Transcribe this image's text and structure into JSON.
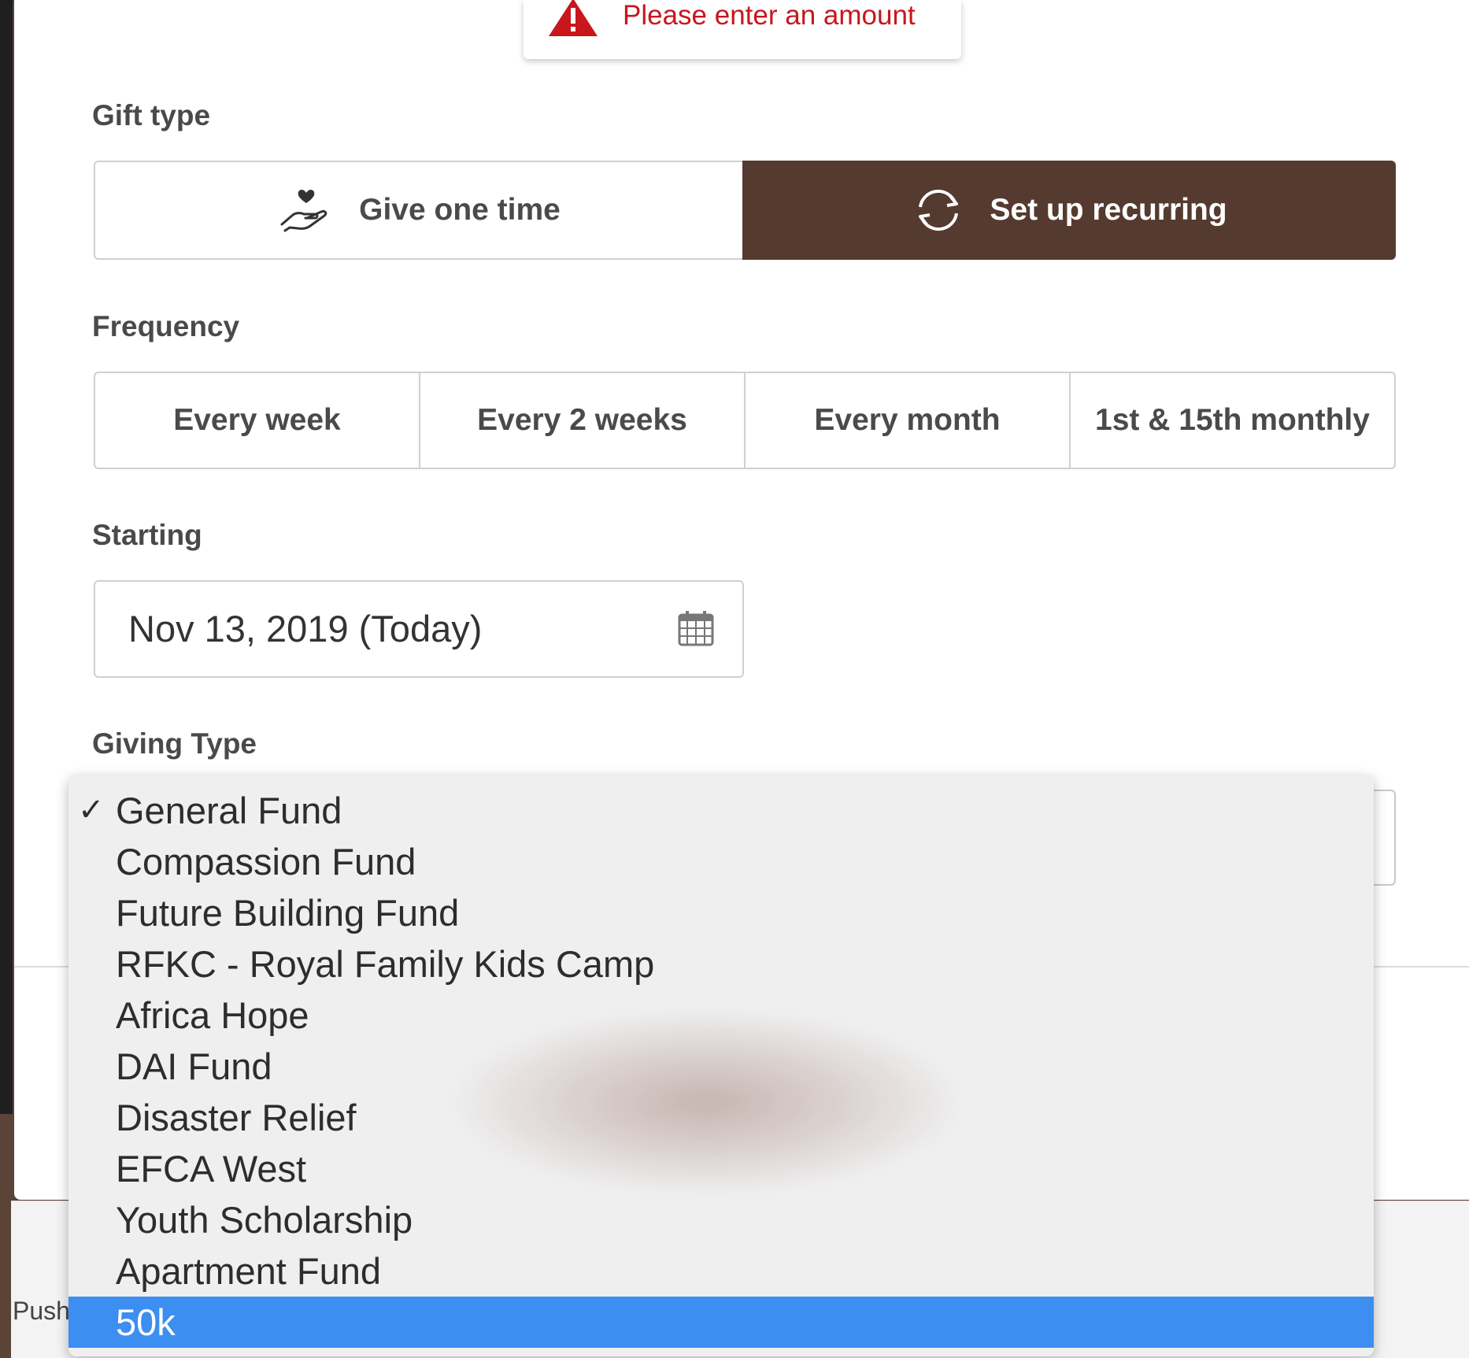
{
  "toast": {
    "message": "Please enter an amount",
    "icon": "warning-triangle-icon"
  },
  "gift_type": {
    "label": "Gift type",
    "options": [
      {
        "label": "Give one time",
        "icon": "hand-heart-icon",
        "selected": false
      },
      {
        "label": "Set up recurring",
        "icon": "recurring-arrows-icon",
        "selected": true
      }
    ]
  },
  "frequency": {
    "label": "Frequency",
    "options": [
      "Every week",
      "Every 2 weeks",
      "Every month",
      "1st & 15th monthly"
    ]
  },
  "starting": {
    "label": "Starting",
    "value": "Nov 13, 2019 (Today)",
    "icon": "calendar-icon"
  },
  "giving_type": {
    "label": "Giving Type",
    "checked": "General Fund",
    "highlighted": "50k",
    "options": [
      "General Fund",
      "Compassion Fund",
      "Future Building Fund",
      "RFKC - Royal Family Kids Camp",
      "Africa Hope",
      "DAI Fund",
      "Disaster Relief",
      "EFCA West",
      "Youth Scholarship",
      "Apartment Fund",
      "50k"
    ]
  },
  "footer": {
    "partial_text": "Push"
  },
  "colors": {
    "accent": "#553a30",
    "error": "#c8161d",
    "highlight": "#3c8ef0"
  }
}
